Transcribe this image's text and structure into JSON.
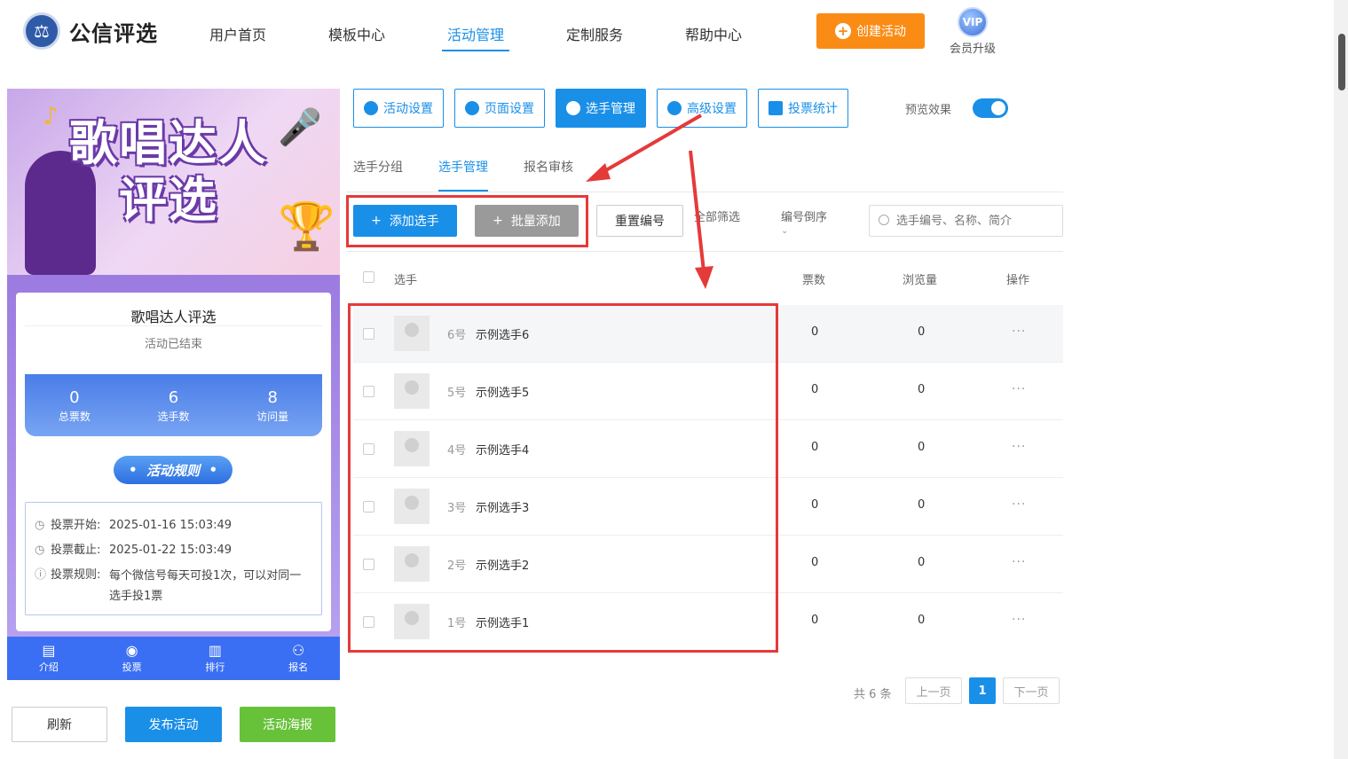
{
  "header": {
    "logo_text": "公信评选",
    "nav": [
      "用户首页",
      "模板中心",
      "活动管理",
      "定制服务",
      "帮助中心"
    ],
    "create_button": "创建活动",
    "vip_badge": "VIP",
    "vip_label": "会员升级"
  },
  "preview": {
    "banner_title_line1": "歌唱达人",
    "banner_title_line2": "评选",
    "activity_title": "歌唱达人评选",
    "activity_status": "活动已结束",
    "stats": [
      {
        "value": "0",
        "label": "总票数"
      },
      {
        "value": "6",
        "label": "选手数"
      },
      {
        "value": "8",
        "label": "访问量"
      }
    ],
    "rules_title": "活动规则",
    "rules": [
      {
        "key": "投票开始:",
        "value": "2025-01-16 15:03:49"
      },
      {
        "key": "投票截止:",
        "value": "2025-01-22 15:03:49"
      },
      {
        "key": "投票规则:",
        "value": "每个微信号每天可投1次，可以对同一选手投1票"
      }
    ],
    "tabbar": [
      {
        "label": "介绍",
        "icon": "document-icon"
      },
      {
        "label": "投票",
        "icon": "vote-icon"
      },
      {
        "label": "排行",
        "icon": "chart-icon"
      },
      {
        "label": "报名",
        "icon": "user-icon"
      }
    ],
    "buttons": {
      "refresh": "刷新",
      "publish": "发布活动",
      "poster": "活动海报"
    }
  },
  "toolbar": {
    "buttons": [
      "活动设置",
      "页面设置",
      "选手管理",
      "高级设置",
      "投票统计"
    ],
    "preview_label": "预览效果"
  },
  "subtabs": [
    "选手分组",
    "选手管理",
    "报名审核"
  ],
  "actions": {
    "add": "添加选手",
    "batch": "批量添加",
    "reset": "重置编号",
    "filter_all": "全部筛选",
    "sort": "编号倒序",
    "search_placeholder": "选手编号、名称、简介"
  },
  "table": {
    "headers": {
      "player": "选手",
      "votes": "票数",
      "views": "浏览量",
      "ops": "操作"
    },
    "rows": [
      {
        "num": "6号",
        "name": "示例选手6",
        "votes": "0",
        "views": "0"
      },
      {
        "num": "5号",
        "name": "示例选手5",
        "votes": "0",
        "views": "0"
      },
      {
        "num": "4号",
        "name": "示例选手4",
        "votes": "0",
        "views": "0"
      },
      {
        "num": "3号",
        "name": "示例选手3",
        "votes": "0",
        "views": "0"
      },
      {
        "num": "2号",
        "name": "示例选手2",
        "votes": "0",
        "views": "0"
      },
      {
        "num": "1号",
        "name": "示例选手1",
        "votes": "0",
        "views": "0"
      }
    ]
  },
  "pagination": {
    "total": "共 6 条",
    "prev": "上一页",
    "current": "1",
    "next": "下一页"
  },
  "colors": {
    "primary": "#1a8fe8",
    "orange": "#fa8c16",
    "green": "#67c23a",
    "annotation_red": "#e53a3a"
  }
}
